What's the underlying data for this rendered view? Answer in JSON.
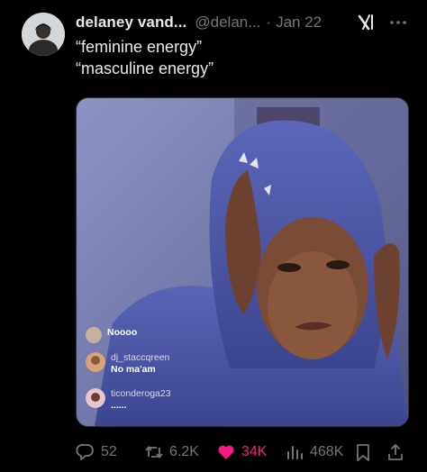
{
  "author": {
    "display_name": "delaney vand...",
    "handle": "@delan...",
    "separator": "·",
    "date": "Jan 22"
  },
  "icons": {
    "grok": "grok-icon",
    "more": "more-icon",
    "reply": "reply-icon",
    "retweet": "retweet-icon",
    "like": "heart-icon",
    "views": "views-icon",
    "bookmark": "bookmark-icon",
    "share": "share-icon"
  },
  "tweet": {
    "lines": [
      "“feminine energy”",
      "“masculine energy”"
    ]
  },
  "media": {
    "comments": [
      {
        "username": "",
        "message": "Noooo"
      },
      {
        "username": "dj_staccqreen",
        "message": "No ma'am"
      },
      {
        "username": "ticonderoga23",
        "message": "......"
      }
    ]
  },
  "actions": {
    "replies": "52",
    "retweets": "6.2K",
    "likes": "34K",
    "views": "468K"
  },
  "colors": {
    "background": "#000000",
    "text_primary": "#e7e9ea",
    "text_secondary": "#71767b",
    "like": "#f91880"
  }
}
